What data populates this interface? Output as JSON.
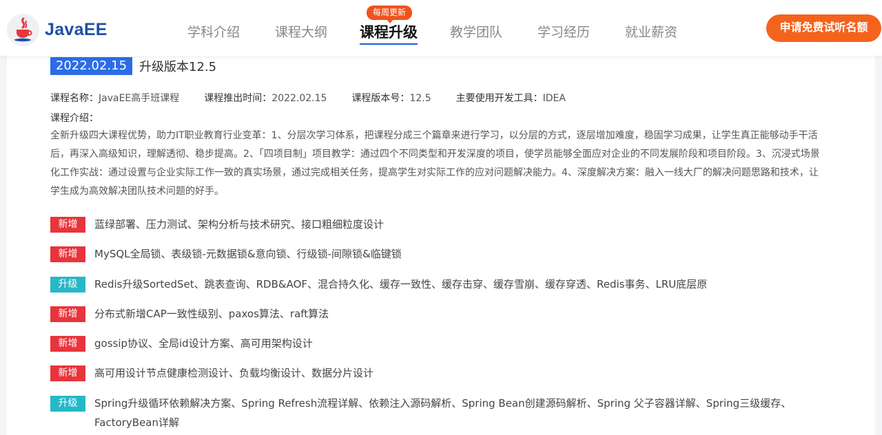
{
  "header": {
    "logo_text": "JavaEE",
    "logo_icon": "java-coffee-cup-icon",
    "nav": [
      {
        "label": "学科介绍",
        "active": false
      },
      {
        "label": "课程大纲",
        "active": false
      },
      {
        "label": "课程升级",
        "active": true
      },
      {
        "label": "教学团队",
        "active": false
      },
      {
        "label": "学习经历",
        "active": false
      },
      {
        "label": "就业薪资",
        "active": false
      }
    ],
    "nav_badge": "每周更新",
    "apply_button": "申请免费试听名额"
  },
  "version": {
    "date": "2022.02.15",
    "title": "升级版本12.5"
  },
  "meta": {
    "course_name_label": "课程名称：",
    "course_name": "JavaEE高手班课程",
    "release_time_label": "课程推出时间：",
    "release_time": "2022.02.15",
    "version_label": "课程版本号：",
    "version_no": "12.5",
    "tool_label": "主要使用开发工具：",
    "tool": "IDEA"
  },
  "intro": {
    "label": "课程介绍：",
    "text": "全新升级四大课程优势，助力IT职业教育行业变革：1、分层次学习体系，把课程分成三个篇章来进行学习，以分层的方式，逐层增加难度，稳固学习成果，让学生真正能够动手干活后，再深入高级知识，理解透彻、稳步提高。2、「四项目制」项目教学：通过四个不同类型和开发深度的项目，使学员能够全面应对企业的不同发展阶段和项目阶段。3、沉浸式场景化工作实战：通过设置与企业实际工作一致的真实场景，通过完成相关任务，提高学生对实际工作的应对问题解决能力。4、深度解决方案：融入一线大厂的解决问题思路和技术，让学生成为高效解决团队技术问题的好手。"
  },
  "changes": [
    {
      "tag": "新增",
      "type": "add",
      "text": "蓝绿部署、压力测试、架构分析与技术研究、接口粗细粒度设计"
    },
    {
      "tag": "新增",
      "type": "add",
      "text": "MySQL全局锁、表级锁-元数据锁&意向锁、行级锁-间隙锁&临键锁"
    },
    {
      "tag": "升级",
      "type": "upg",
      "text": "Redis升级SortedSet、跳表查询、RDB&AOF、混合持久化、缓存一致性、缓存击穿、缓存雪崩、缓存穿透、Redis事务、LRU底层原"
    },
    {
      "tag": "新增",
      "type": "add",
      "text": "分布式新增CAP一致性级别、paxos算法、raft算法"
    },
    {
      "tag": "新增",
      "type": "add",
      "text": "gossip协议、全局id设计方案、高可用架构设计"
    },
    {
      "tag": "新增",
      "type": "add",
      "text": "高可用设计节点健康检测设计、负载均衡设计、数据分片设计"
    },
    {
      "tag": "升级",
      "type": "upg",
      "text": "Spring升级循环依赖解决方案、Spring Refresh流程详解、依赖注入源码解析、Spring Bean创建源码解析、Spring 父子容器详解、Spring三级缓存、FactoryBean详解"
    }
  ],
  "colors": {
    "brand_blue": "#1e4fa8",
    "date_badge": "#2b6de8",
    "accent_orange": "#f4631c",
    "tag_add": "#e8343c",
    "tag_upgrade": "#27b8c8"
  }
}
